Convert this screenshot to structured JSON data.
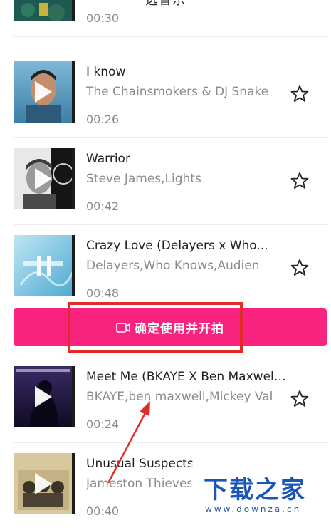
{
  "header": {
    "title": "选音乐",
    "back_glyph": "‹"
  },
  "songs": [
    {
      "title": "",
      "artist": "",
      "duration": "00:30",
      "cover": "cover-art-forest",
      "starred": false
    },
    {
      "title": "I know",
      "artist": "The Chainsmokers & DJ Snake",
      "duration": "00:26",
      "cover": "cover-art-portrait-blue",
      "starred": false
    },
    {
      "title": "Warrior",
      "artist": "Steve James,Lights",
      "duration": "00:42",
      "cover": "cover-art-portrait-bw",
      "starred": false
    },
    {
      "title": "Crazy Love (Delayers x Who...",
      "artist": "Delayers,Who Knows,Audien",
      "duration": "00:48",
      "cover": "cover-art-crazy-love",
      "starred": false,
      "playing": true
    },
    {
      "title": "Meet Me (BKAYE X Ben Maxwell...",
      "artist": "BKAYE,ben maxwell,Mickey Valen",
      "duration": "00:24",
      "cover": "cover-art-meet-me",
      "starred": false
    },
    {
      "title": "Unusual Suspects",
      "artist": "Jameston Thieves",
      "duration": "00:40",
      "cover": "cover-art-unusual-suspects",
      "starred": false
    }
  ],
  "confirm_button": {
    "label": "确定使用并开拍",
    "icon": "video-camera-icon"
  },
  "watermark": {
    "logo": "下载之家",
    "url": "www.downza.cn"
  },
  "colors": {
    "accent": "#f7237e",
    "annotation": "#e12b27",
    "watermark": "#1a56b8"
  }
}
